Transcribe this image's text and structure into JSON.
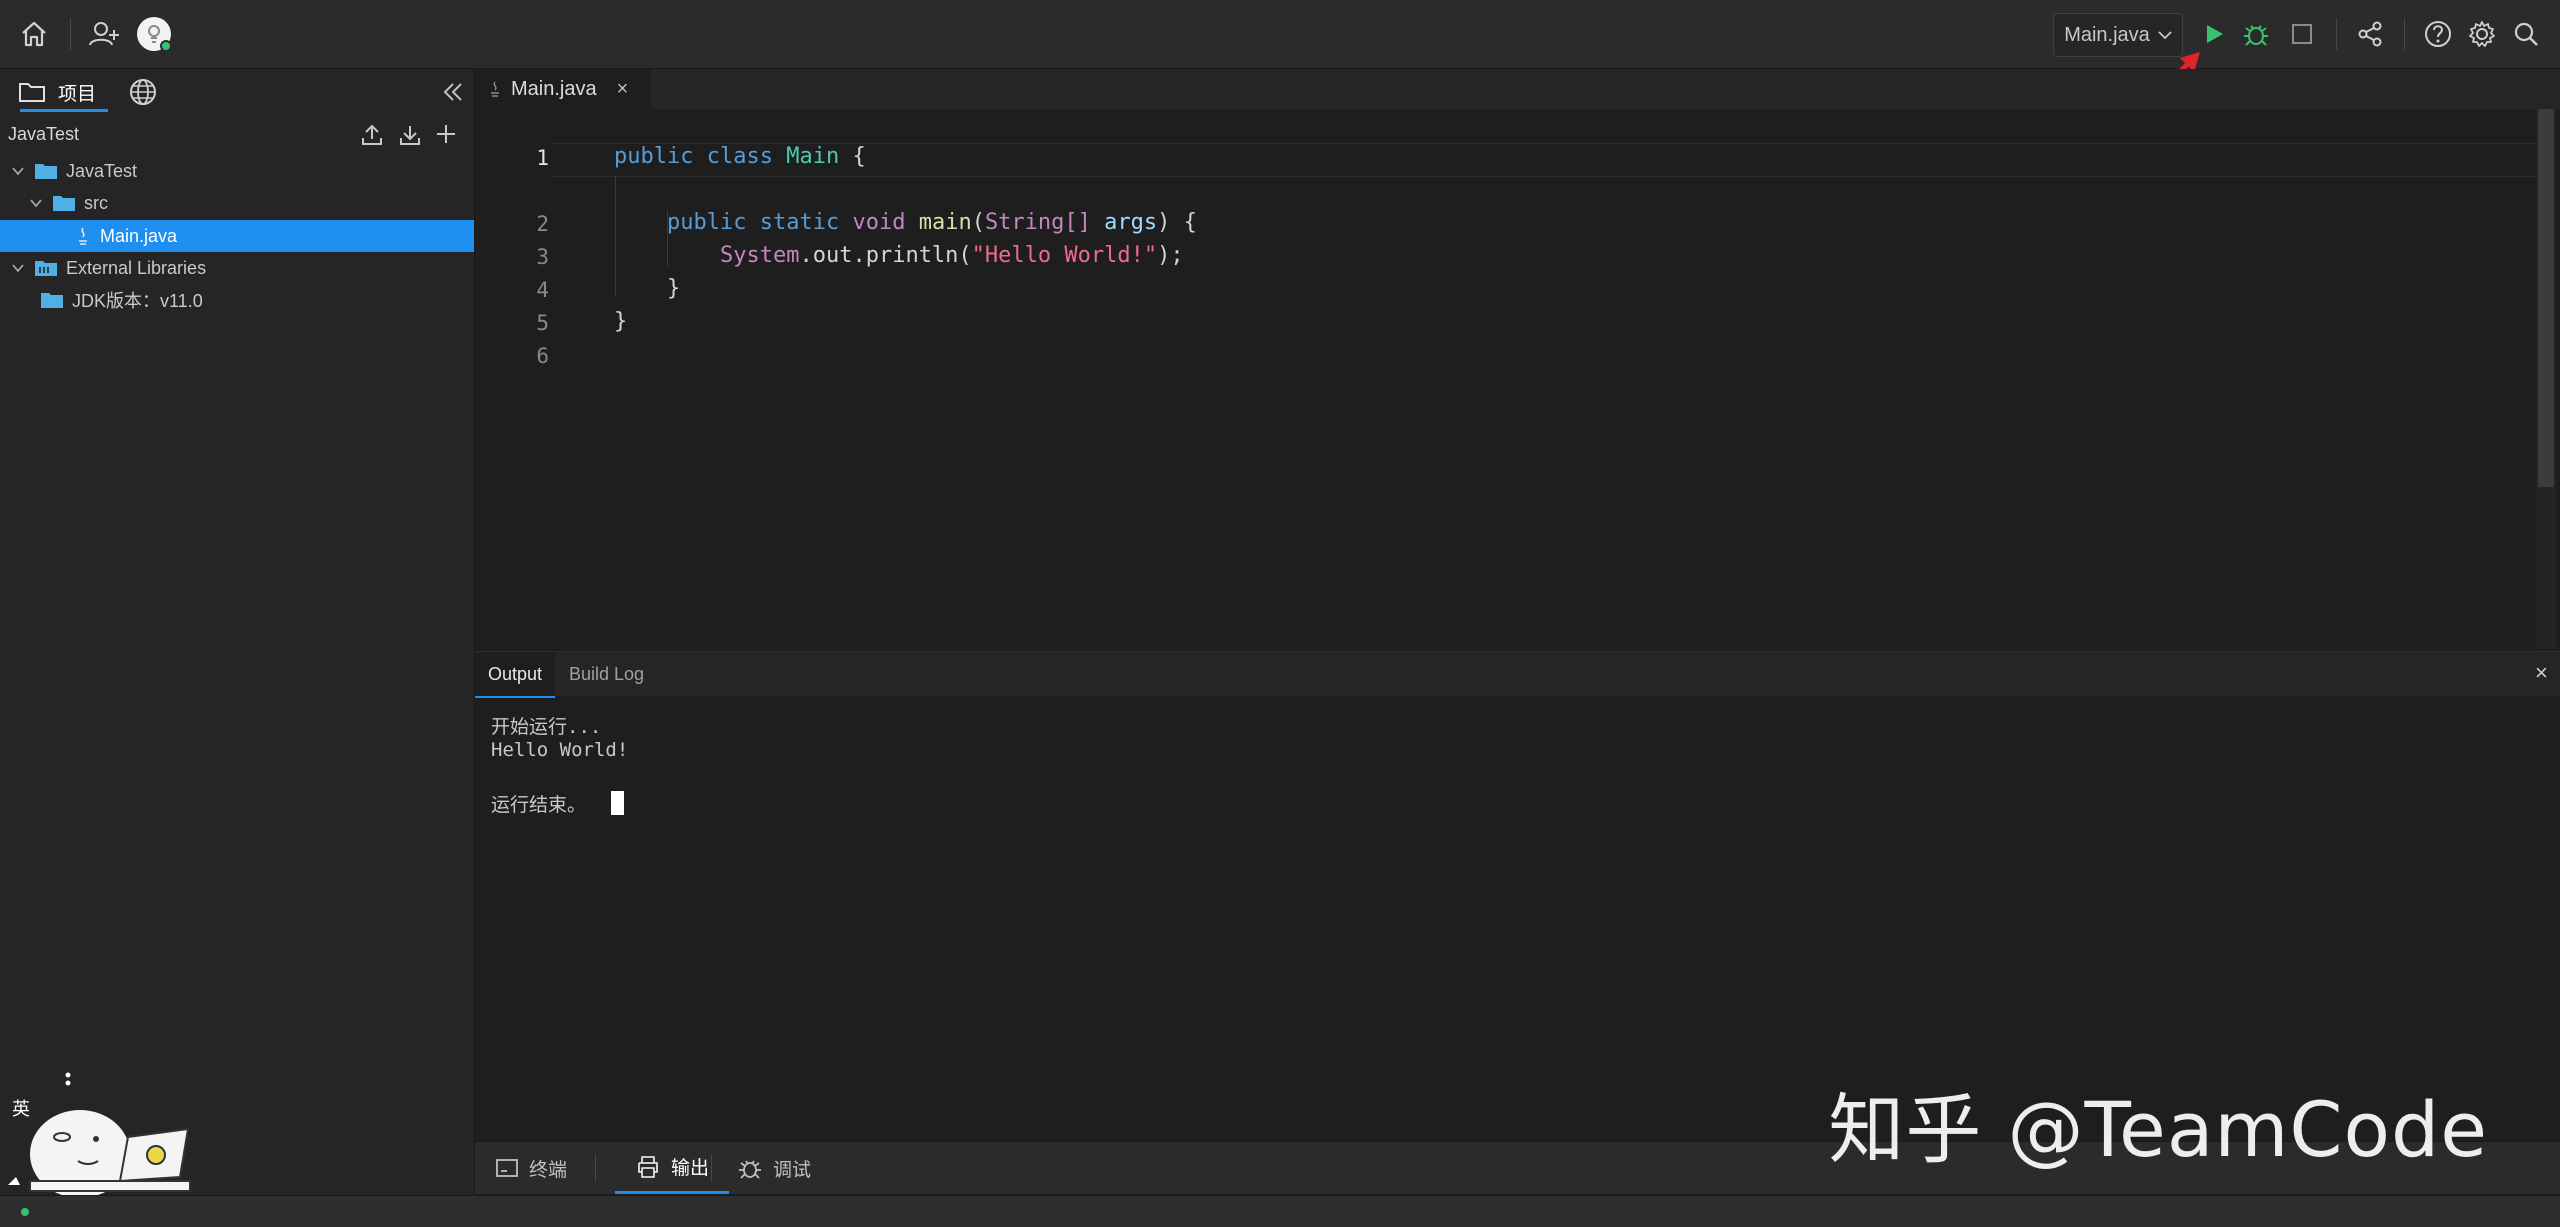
{
  "sidebar": {
    "tabs": [
      {
        "label": "项目"
      }
    ],
    "project_name": "JavaTest",
    "tree": [
      {
        "label": "JavaTest"
      },
      {
        "label": "src"
      },
      {
        "label": "Main.java"
      },
      {
        "label": "External Libraries"
      },
      {
        "label": "JDK版本：v11.0"
      }
    ]
  },
  "toolbar": {
    "run_config": "Main.java"
  },
  "editor": {
    "tab": {
      "label": "Main.java",
      "close": "×"
    },
    "line_numbers": [
      "1",
      "2",
      "3",
      "4",
      "5",
      "6"
    ],
    "code": {
      "public": "public",
      "class": "class",
      "class_name": "Main",
      "brace_open": "{",
      "static": "static",
      "void": "void",
      "method": "main",
      "paren_open": "(",
      "param_type": "String[]",
      "param": "args",
      "paren_close_brace": ") {",
      "system": "System",
      "out_println": ".out.println(",
      "string": "\"Hello World!\"",
      "stmt_end": ");",
      "brace_close": "}"
    }
  },
  "panel": {
    "tabs": [
      {
        "label": "Output"
      },
      {
        "label": "Build Log"
      }
    ],
    "close": "×",
    "output_lines": [
      "开始运行...",
      "Hello World!",
      "运行结束。"
    ]
  },
  "bottom_tabs": [
    {
      "label": "终端"
    },
    {
      "label": "输出"
    },
    {
      "label": "调试"
    }
  ],
  "ime": {
    "label": "英"
  },
  "watermark": "知乎 @TeamCode",
  "colors": {
    "accent": "#1f8ef1",
    "run": "#3ac16f",
    "annotation": "#e0222a"
  }
}
